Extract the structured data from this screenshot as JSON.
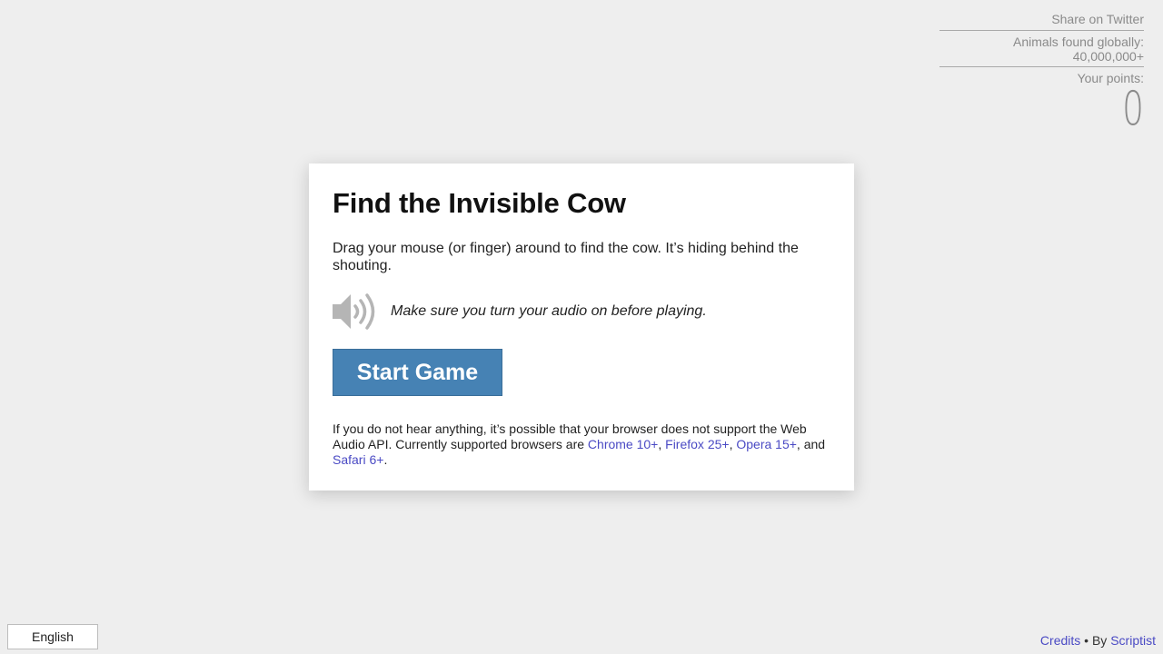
{
  "header": {
    "share_label": "Share on Twitter",
    "animals_found": "Animals found globally: 40,000,000+",
    "points_label": "Your points:",
    "points_value": "0"
  },
  "card": {
    "title": "Find the Invisible Cow",
    "intro": "Drag your mouse (or finger) around to find the cow. It’s hiding behind the shouting.",
    "speaker_icon": "speaker-volume-icon",
    "audio_note": "Make sure you turn your audio on before playing.",
    "start_label": "Start Game",
    "note_prefix": "If you do not hear anything, it’s possible that your browser does not support the Web Audio API. Currently supported browsers are ",
    "browsers": [
      "Chrome 10+",
      "Firefox 25+",
      "Opera 15+",
      "Safari 6+"
    ],
    "sep_1": ", ",
    "sep_2": ", ",
    "sep_3": ", and ",
    "note_suffix": "."
  },
  "footer": {
    "language": "English",
    "credits_label": "Credits",
    "by_text": " • By ",
    "author": "Scriptist"
  },
  "colors": {
    "background": "#eeeeee",
    "button": "#4682b4",
    "link": "#4a4ac4"
  }
}
